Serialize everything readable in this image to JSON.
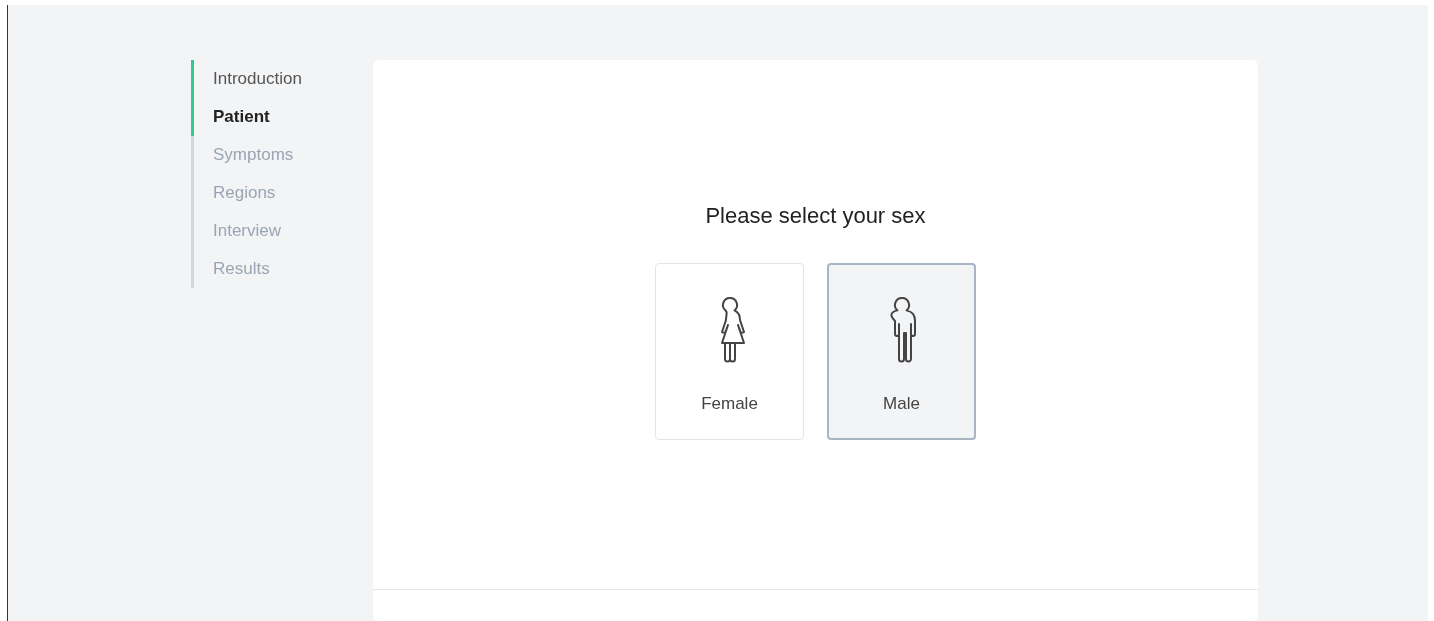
{
  "steps": [
    {
      "label": "Introduction",
      "completed": true,
      "selected": false
    },
    {
      "label": "Patient",
      "completed": true,
      "selected": true
    },
    {
      "label": "Symptoms",
      "completed": false,
      "selected": false
    },
    {
      "label": "Regions",
      "completed": false,
      "selected": false
    },
    {
      "label": "Interview",
      "completed": false,
      "selected": false
    },
    {
      "label": "Results",
      "completed": false,
      "selected": false
    }
  ],
  "question": "Please select your sex",
  "options": [
    {
      "kind": "female",
      "label": "Female",
      "selected": false
    },
    {
      "kind": "male",
      "label": "Male",
      "selected": true
    }
  ]
}
